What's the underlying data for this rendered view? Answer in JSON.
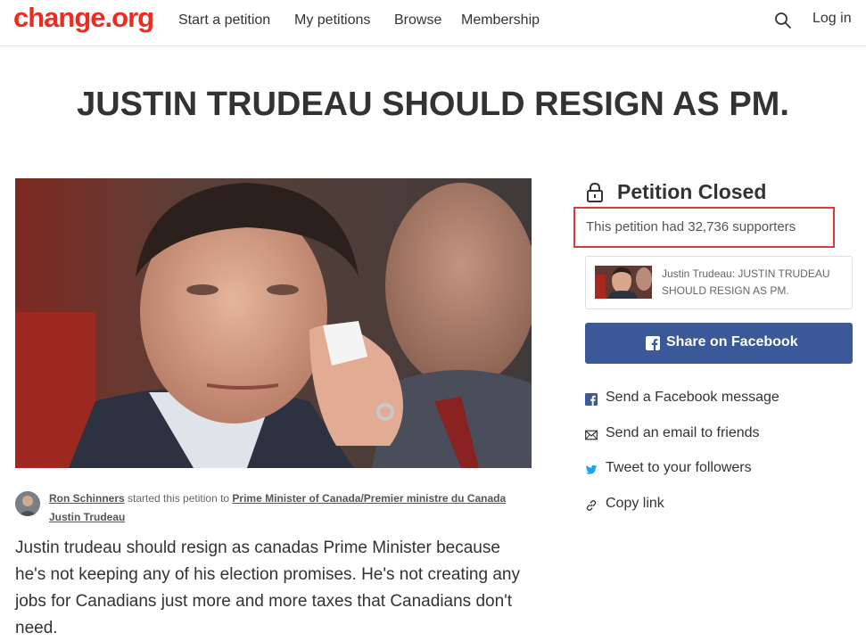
{
  "header": {
    "logo": "change.org",
    "nav": [
      "Start a petition",
      "My petitions",
      "Browse",
      "Membership"
    ],
    "login": "Log in"
  },
  "petition": {
    "title": "JUSTIN TRUDEAU SHOULD RESIGN AS PM.",
    "starter_name": "Ron Schinners",
    "starter_middle": " started this petition to ",
    "recipient": "Prime Minister of Canada/Premier ministre du Canada Justin Trudeau",
    "description": "Justin trudeau should resign as canadas Prime Minister because he's not keeping any of his election promises. He's not creating any jobs for Canadians just more and more taxes that Canadians don't need."
  },
  "sidebar": {
    "status": "Petition Closed",
    "supporters_text": "This petition had 32,736 supporters",
    "share_card_text": "Justin Trudeau: JUSTIN TRUDEAU SHOULD RESIGN AS PM.",
    "facebook_button": "Share on Facebook",
    "share_options": [
      {
        "label": "Send a Facebook message",
        "icon": "facebook-icon"
      },
      {
        "label": "Send an email to friends",
        "icon": "email-icon"
      },
      {
        "label": "Tweet to your followers",
        "icon": "twitter-icon"
      },
      {
        "label": "Copy link",
        "icon": "link-icon"
      }
    ]
  },
  "colors": {
    "brand": "#ec2c22",
    "facebook": "#3b5998",
    "twitter": "#1da1f2",
    "highlight_border": "#d93a3a"
  }
}
